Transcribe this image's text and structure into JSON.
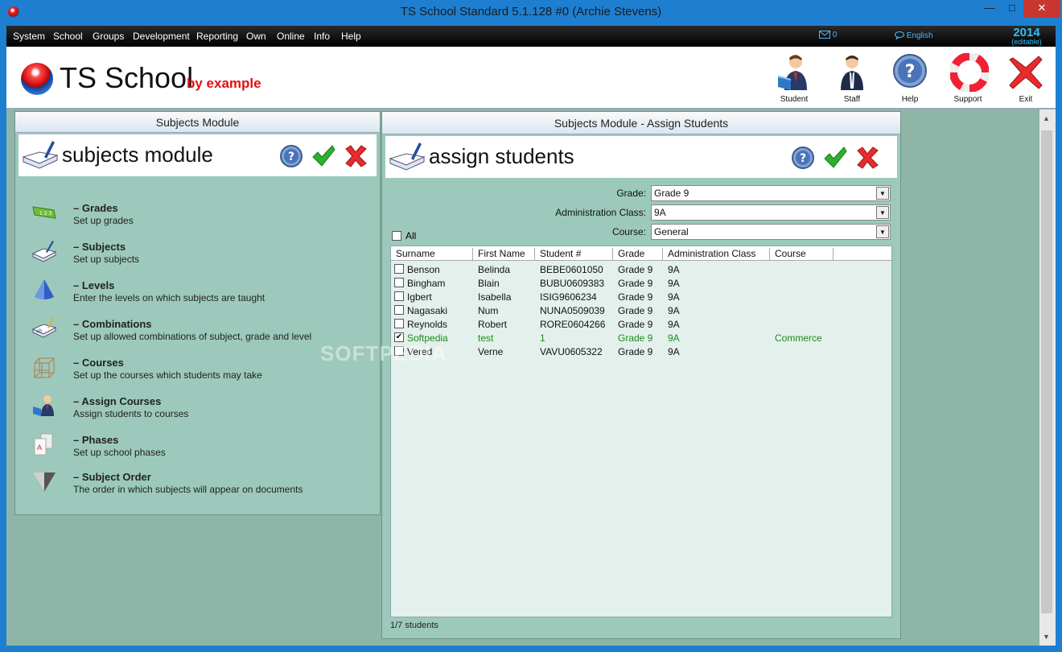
{
  "window": {
    "title": "TS School Standard 5.1.128 #0 (Archie Stevens)"
  },
  "menu": {
    "items": [
      "System",
      "School",
      "Groups",
      "Development",
      "Reporting",
      "Own",
      "Online",
      "Info",
      "Help"
    ],
    "mail_count": "0",
    "language": "English",
    "year": "2014",
    "edition": "(editable)"
  },
  "header": {
    "logo_text": "TS School",
    "logo_by": "by example",
    "toolbar": [
      "Student",
      "Staff",
      "Help",
      "Support",
      "Exit"
    ]
  },
  "left_panel": {
    "title": "Subjects Module",
    "heading": "subjects module",
    "items": [
      {
        "title": "Grades",
        "desc": "Set up grades",
        "icon": "grades-icon"
      },
      {
        "title": "Subjects",
        "desc": "Set up subjects",
        "icon": "subjects-book-icon"
      },
      {
        "title": "Levels",
        "desc": "Enter the levels on which subjects are taught",
        "icon": "cone-icon"
      },
      {
        "title": "Combinations",
        "desc": "Set up allowed combinations of subject, grade and level",
        "icon": "combinations-icon"
      },
      {
        "title": "Courses",
        "desc": "Set up the courses which students may take",
        "icon": "courses-cube-icon"
      },
      {
        "title": "Assign Courses",
        "desc": "Assign students to courses",
        "icon": "assign-user-icon"
      },
      {
        "title": "Phases",
        "desc": "Set up school phases",
        "icon": "phases-icon"
      },
      {
        "title": "Subject Order",
        "desc": "The order in which subjects will appear on documents",
        "icon": "funnel-icon"
      }
    ],
    "dash": "–"
  },
  "right_panel": {
    "title": "Subjects Module - Assign Students",
    "heading": "assign students",
    "filters": {
      "grade_label": "Grade:",
      "grade_value": "Grade 9",
      "class_label": "Administration Class:",
      "class_value": "9A",
      "course_label": "Course:",
      "course_value": "General"
    },
    "all_label": "All",
    "columns": [
      "Surname",
      "First Name",
      "Student #",
      "Grade",
      "Administration Class",
      "Course"
    ],
    "rows": [
      {
        "checked": false,
        "cells": [
          "Benson",
          "Belinda",
          "BEBE0601050",
          "Grade 9",
          "9A",
          ""
        ]
      },
      {
        "checked": false,
        "cells": [
          "Bingham",
          "Blain",
          "BUBU0609383",
          "Grade 9",
          "9A",
          ""
        ]
      },
      {
        "checked": false,
        "cells": [
          "Igbert",
          "Isabella",
          "ISIG9606234",
          "Grade 9",
          "9A",
          ""
        ]
      },
      {
        "checked": false,
        "cells": [
          "Nagasaki",
          "Num",
          "NUNA0509039",
          "Grade 9",
          "9A",
          ""
        ]
      },
      {
        "checked": false,
        "cells": [
          "Reynolds",
          "Robert",
          "RORE0604266",
          "Grade 9",
          "9A",
          ""
        ]
      },
      {
        "checked": true,
        "cells": [
          "Softpedia",
          "test",
          "1",
          "Grade 9",
          "9A",
          "Commerce"
        ]
      },
      {
        "checked": false,
        "cells": [
          "Vered",
          "Verne",
          "VAVU0605322",
          "Grade 9",
          "9A",
          ""
        ]
      }
    ],
    "footer": "1/7 students"
  },
  "watermark": "SOFTPEDIA",
  "colors": {
    "panel_bg": "#9cc9bb",
    "selected_row_text": "#1a8c1a",
    "title_bar": "#1e7fd0"
  }
}
